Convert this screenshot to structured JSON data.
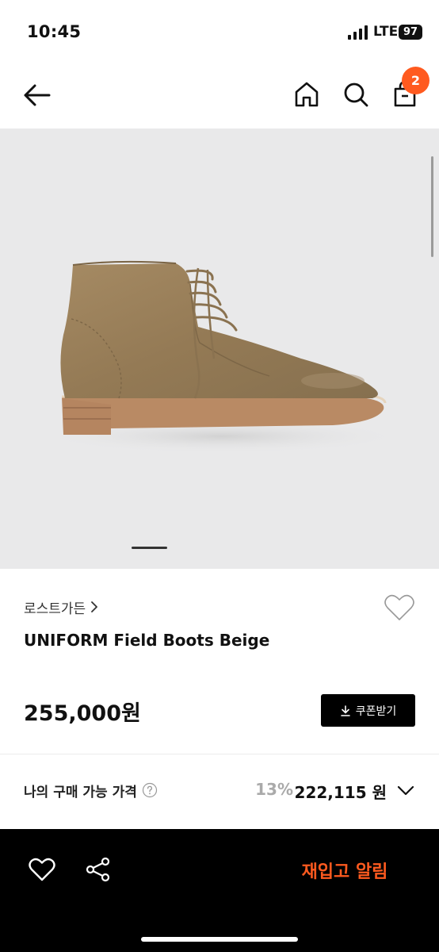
{
  "status_bar": {
    "time": "10:45",
    "network": "LTE",
    "battery": "97",
    "icons": [
      "signal-icon",
      "battery-icon"
    ]
  },
  "nav": {
    "icons": [
      "back-arrow-icon",
      "home-icon",
      "search-icon",
      "shopping-bag-icon"
    ],
    "cart_count": "2",
    "badge_color": "#ff5a1f"
  },
  "gallery": {
    "image": "suede lace-up boot on grey background",
    "current_page": 1
  },
  "product": {
    "brand": "로스트가든",
    "name": "UNIFORM Field Boots Beige",
    "price": "255,000원",
    "coupon_label": "쿠폰받기",
    "icons": [
      "chevron-right-icon",
      "heart-outline-icon",
      "download-icon"
    ]
  },
  "my_price": {
    "label": "나의 구매 가능 가격",
    "discount_rate": "13%",
    "discount_price": "222,115 원",
    "icons": [
      "help-circle-icon",
      "chevron-down-icon"
    ]
  },
  "bottom_bar": {
    "restock_label": "재입고 알림",
    "accent_color": "#ff5a1f",
    "icons": [
      "heart-outline-icon",
      "share-icon"
    ]
  }
}
